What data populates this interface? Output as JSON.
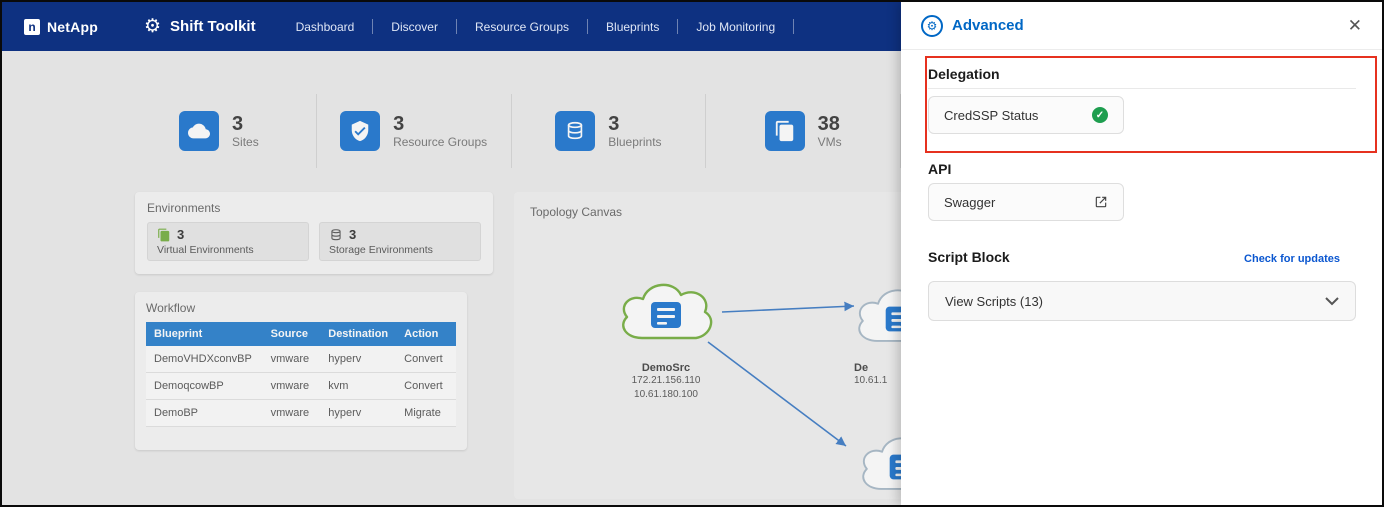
{
  "colors": {
    "navbar_blue": "#0e3181",
    "accent_blue": "#0067c5",
    "icon_blue": "#1f76d2",
    "table_header_blue": "#2a81cf",
    "highlight_red": "#e6311f",
    "status_green": "#1e9e4f",
    "cloud_green": "#76b041"
  },
  "icons": {
    "app_gear": "⚙",
    "advanced_gear": "⚙",
    "close": "✕",
    "check": "✓",
    "netapp_mark": "n"
  },
  "navbar": {
    "brand": "NetApp",
    "app_title": "Shift Toolkit",
    "items": [
      {
        "label": "Dashboard"
      },
      {
        "label": "Discover"
      },
      {
        "label": "Resource Groups"
      },
      {
        "label": "Blueprints"
      },
      {
        "label": "Job Monitoring"
      }
    ]
  },
  "stats": [
    {
      "value": "3",
      "label": "Sites",
      "icon": "cloud-icon"
    },
    {
      "value": "3",
      "label": "Resource Groups",
      "icon": "shield-check-icon"
    },
    {
      "value": "3",
      "label": "Blueprints",
      "icon": "database-icon"
    },
    {
      "value": "38",
      "label": "VMs",
      "icon": "vm-copy-icon"
    }
  ],
  "environments": {
    "title": "Environments",
    "items": [
      {
        "value": "3",
        "label": "Virtual Environments",
        "icon": "virtual-env-icon"
      },
      {
        "value": "3",
        "label": "Storage Environments",
        "icon": "storage-env-icon"
      }
    ]
  },
  "workflow": {
    "title": "Workflow",
    "columns": [
      "Blueprint",
      "Source",
      "Destination",
      "Action"
    ],
    "rows": [
      {
        "blueprint": "DemoVHDXconvBP",
        "source": "vmware",
        "destination": "hyperv",
        "action": "Convert"
      },
      {
        "blueprint": "DemoqcowBP",
        "source": "vmware",
        "destination": "kvm",
        "action": "Convert"
      },
      {
        "blueprint": "DemoBP",
        "source": "vmware",
        "destination": "hyperv",
        "action": "Migrate"
      }
    ]
  },
  "topology": {
    "title": "Topology Canvas",
    "source_node": {
      "name": "DemoSrc",
      "ip_lines": [
        "172.21.156.110",
        "10.61.180.100"
      ]
    },
    "dest_node": {
      "name_fragment": "De",
      "ip_fragment": "10.61.1"
    }
  },
  "panel": {
    "title": "Advanced",
    "delegation": {
      "heading": "Delegation",
      "credssp_label": "CredSSP Status"
    },
    "api": {
      "heading": "API",
      "swagger_label": "Swagger"
    },
    "script_block": {
      "heading": "Script Block",
      "updates_link": "Check for updates",
      "dropdown_label": "View Scripts (13)"
    }
  }
}
